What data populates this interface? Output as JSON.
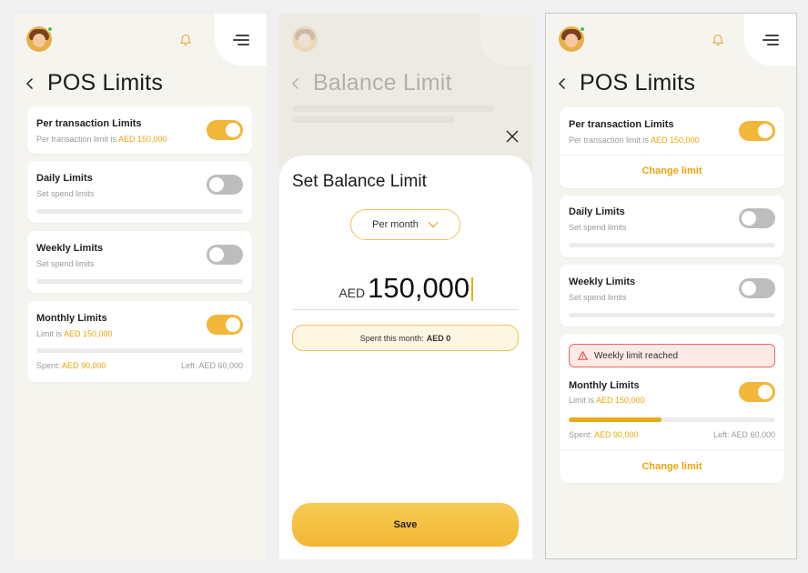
{
  "colors": {
    "accent": "#eaaa15",
    "toggle_on": "#f2b638",
    "toggle_off": "#bdbdbd",
    "alert_border": "#ea6a5e",
    "alert_bg": "#fde9e6"
  },
  "screen1": {
    "title": "POS Limits",
    "cards": {
      "per_transaction": {
        "title": "Per transaction Limits",
        "sub_prefix": "Per transaction limit is ",
        "sub_amount": "AED 150,000",
        "toggle": "on"
      },
      "daily": {
        "title": "Daily Limits",
        "sub": "Set spend limits",
        "toggle": "off"
      },
      "weekly": {
        "title": "Weekly Limits",
        "sub": "Set spend limits",
        "toggle": "off"
      },
      "monthly": {
        "title": "Monthly Limits",
        "sub_prefix": "Limit is ",
        "sub_amount": "AED 150,000",
        "toggle": "on",
        "spent_label": "Spent: ",
        "spent_amount": "AED 90,000",
        "left": "Left: AED 60,000"
      }
    }
  },
  "screen2": {
    "bg_title": "Balance Limit",
    "sheet_title": "Set Balance Limit",
    "period": "Per month",
    "currency": "AED",
    "amount": "150,000",
    "spent_label": "Spent this month:",
    "spent_value": "AED 0",
    "save_label": "Save"
  },
  "screen3": {
    "title": "POS Limits",
    "cards": {
      "per_transaction": {
        "title": "Per transaction Limits",
        "sub_prefix": "Per transaction limit is ",
        "sub_amount": "AED 150,000",
        "toggle": "on",
        "change_label": "Change limit"
      },
      "daily": {
        "title": "Daily Limits",
        "sub": "Set spend limits",
        "toggle": "off"
      },
      "weekly": {
        "title": "Weekly Limits",
        "sub": "Set spend limits",
        "toggle": "off"
      },
      "monthly": {
        "alert": "Weekly limit reached",
        "title": "Monthly Limits",
        "sub_prefix": "Limit is ",
        "sub_amount": "AED 150,000",
        "toggle": "on",
        "progress": 0.45,
        "spent_label": "Spent: ",
        "spent_amount": "AED 90,000",
        "left": "Left: AED 60,000",
        "change_label": "Change limit"
      }
    }
  }
}
